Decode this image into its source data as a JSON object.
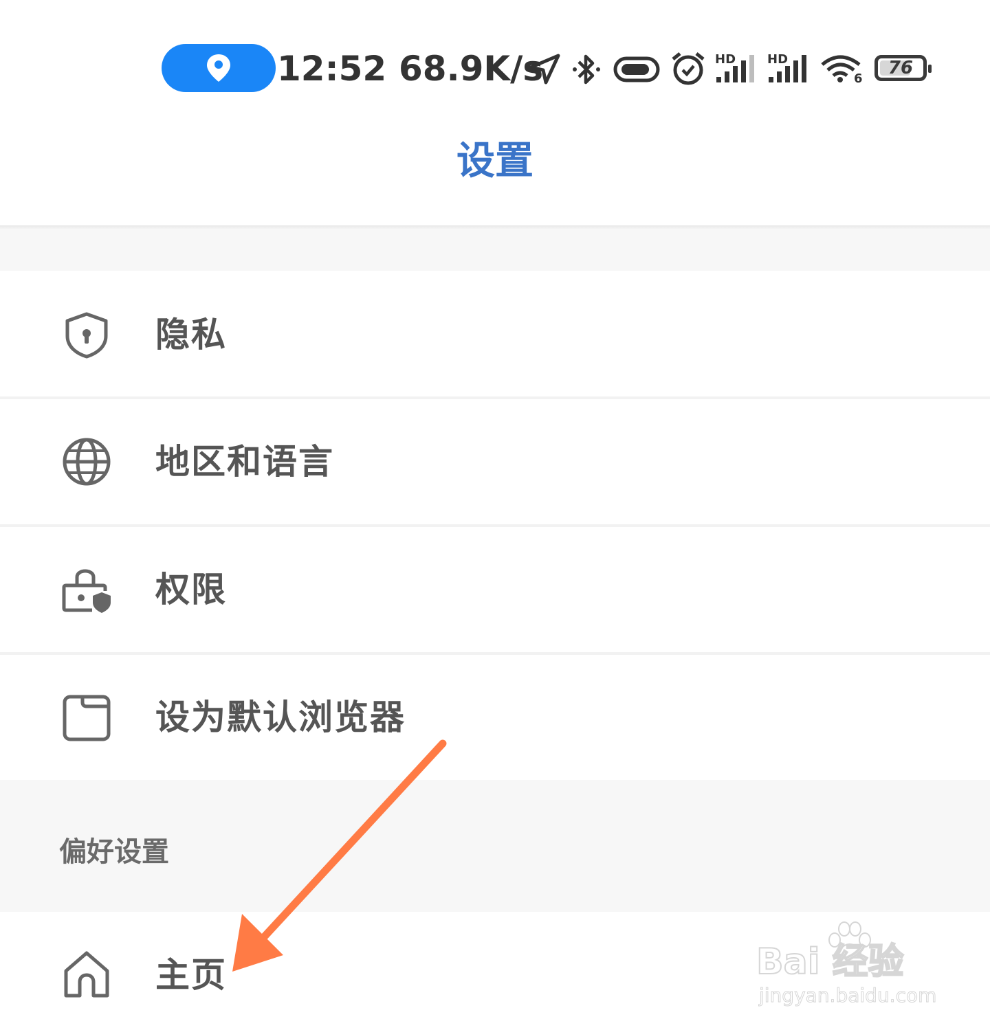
{
  "status_bar": {
    "time": "12:52",
    "network_speed": "68.9K/s",
    "battery_level": "76",
    "battery_fraction": 0.76,
    "location_pill_color": "#1a86f7",
    "icons": [
      "location-pin-icon",
      "navigation-arrow-icon",
      "bluetooth-icon",
      "nfc-pill-icon",
      "alarm-icon",
      "hd-signal-icon",
      "hd-signal-icon",
      "wifi-icon",
      "battery-icon"
    ],
    "signal_badges": [
      "HD",
      "HD"
    ],
    "wifi_badge": "6"
  },
  "header": {
    "title": "设置",
    "title_color": "#3a74c8"
  },
  "settings_items": [
    {
      "label": "隐私",
      "icon": "shield-lock-icon"
    },
    {
      "label": "地区和语言",
      "icon": "globe-icon"
    },
    {
      "label": "权限",
      "icon": "lock-shield-icon"
    },
    {
      "label": "设为默认浏览器",
      "icon": "browser-window-icon"
    }
  ],
  "preferences": {
    "section_title": "偏好设置",
    "items": [
      {
        "label": "主页",
        "icon": "home-icon"
      }
    ]
  },
  "annotation": {
    "arrow_color": "#ff7b45"
  },
  "watermark": {
    "brand": "Bai  经验",
    "url": "jingyan.baidu.com"
  }
}
